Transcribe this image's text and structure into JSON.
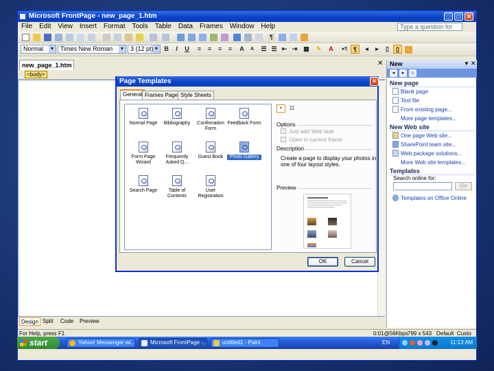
{
  "window": {
    "title": "Microsoft FrontPage - new_page_1.htm",
    "help_placeholder": "Type a question for help"
  },
  "menu": [
    "File",
    "Edit",
    "View",
    "Insert",
    "Format",
    "Tools",
    "Table",
    "Data",
    "Frames",
    "Window",
    "Help"
  ],
  "formatting": {
    "style": "Normal",
    "font": "Times New Roman",
    "size": "3 (12 pt)"
  },
  "document": {
    "tab": "new_page_1.htm",
    "tag": "<body>"
  },
  "views": {
    "design": "Design",
    "split": "Split",
    "code": "Code",
    "preview": "Preview"
  },
  "status": {
    "left": "For Help, press F1",
    "speed": "0:01@56Kbps",
    "size": "799 x 543",
    "mode": "Default",
    "custom": "Custo"
  },
  "taskpane": {
    "title": "New",
    "new_page": {
      "heading": "New page",
      "links": [
        "Blank page",
        "Text file",
        "From existing page...",
        "More page templates..."
      ]
    },
    "new_site": {
      "heading": "New Web site",
      "links": [
        "One page Web site...",
        "SharePoint team site...",
        "Web package solutions...",
        "More Web site templates..."
      ]
    },
    "templates": {
      "heading": "Templates",
      "search_label": "Search online for:",
      "go": "Go",
      "office_link": "Templates on Office Online"
    }
  },
  "dialog": {
    "title": "Page Templates",
    "tabs": [
      "General",
      "Frames Pages",
      "Style Sheets"
    ],
    "templates": [
      "Normal Page",
      "Bibliography",
      "Confirmation Form",
      "Feedback Form",
      "Form Page Wizard",
      "Frequently Asked Q...",
      "Guest Book",
      "Photo Gallery",
      "Search Page",
      "Table of Contents",
      "User Registration"
    ],
    "selected": "Photo Gallery",
    "options_label": "Options",
    "option_add": "Just add Web task",
    "option_open": "Open in current frame",
    "description_label": "Description",
    "description": "Create a page to display your photos in one of four layout styles.",
    "preview_label": "Preview",
    "ok": "OK",
    "cancel": "Cancel"
  },
  "taskbar": {
    "start": "start",
    "tasks": [
      "Yahoo! Messenger wi...",
      "Microsoft FrontPage -...",
      "untitled1 - Paint"
    ],
    "lang": "EN",
    "time": "11:13 AM"
  }
}
